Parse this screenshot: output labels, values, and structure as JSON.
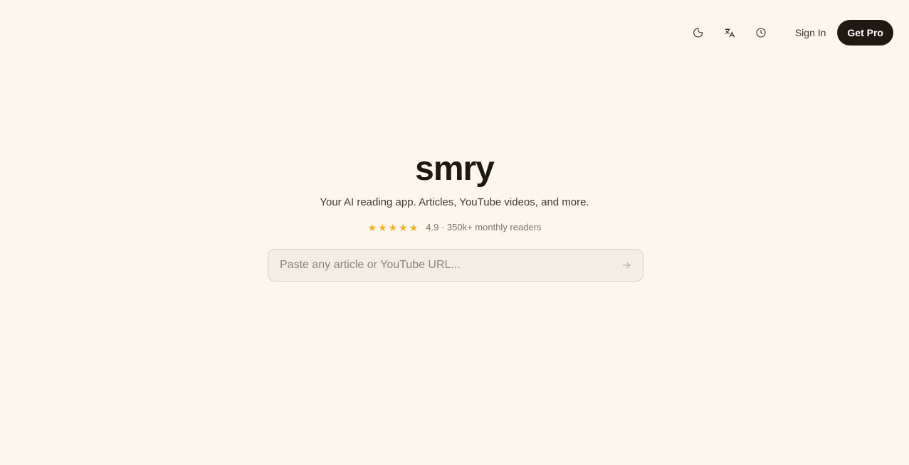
{
  "header": {
    "icons": {
      "theme": "moon-icon",
      "language": "translate-icon",
      "history": "clock-icon"
    },
    "sign_in_label": "Sign In",
    "get_pro_label": "Get Pro"
  },
  "hero": {
    "logo": "smry",
    "tagline": "Your AI reading app. Articles, YouTube videos, and more.",
    "rating": {
      "stars": 5,
      "text": "4.9 · 350k+ monthly readers"
    }
  },
  "search": {
    "placeholder": "Paste any article or YouTube URL...",
    "value": "",
    "submit_icon": "arrow-right-icon"
  },
  "colors": {
    "background": "#fcf6ec",
    "primary_button": "#1f1912",
    "star": "#f2b01e"
  }
}
